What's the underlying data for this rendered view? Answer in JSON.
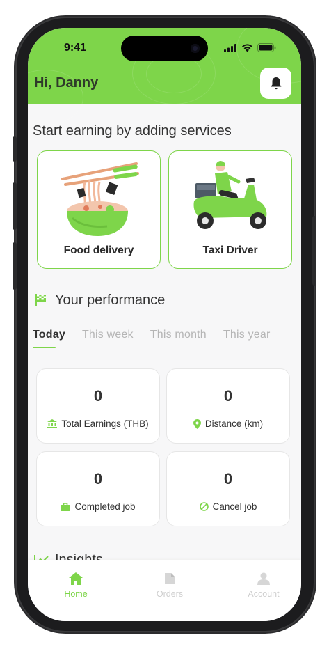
{
  "status_bar": {
    "time": "9:41"
  },
  "header": {
    "greeting": "Hi, Danny"
  },
  "services": {
    "title": "Start earning by adding services",
    "items": [
      {
        "label": "Food delivery",
        "icon": "noodle-bowl-illustration"
      },
      {
        "label": "Taxi Driver",
        "icon": "scooter-rider-illustration"
      }
    ]
  },
  "performance": {
    "title": "Your performance",
    "tabs": [
      "Today",
      "This week",
      "This month",
      "This year"
    ],
    "active_tab": "Today",
    "stats": [
      {
        "value": "0",
        "label": "Total Earnings (THB)",
        "icon": "bank-icon"
      },
      {
        "value": "0",
        "label": "Distance (km)",
        "icon": "location-pin-icon"
      },
      {
        "value": "0",
        "label": "Completed job",
        "icon": "briefcase-icon"
      },
      {
        "value": "0",
        "label": "Cancel job",
        "icon": "cancel-icon"
      }
    ]
  },
  "insights": {
    "title": "Insights"
  },
  "bottom_nav": {
    "items": [
      {
        "label": "Home",
        "icon": "home-icon"
      },
      {
        "label": "Orders",
        "icon": "document-icon"
      },
      {
        "label": "Account",
        "icon": "user-icon"
      }
    ]
  },
  "colors": {
    "accent": "#7ed54a",
    "text": "#333333",
    "muted": "#b5b5b5"
  }
}
